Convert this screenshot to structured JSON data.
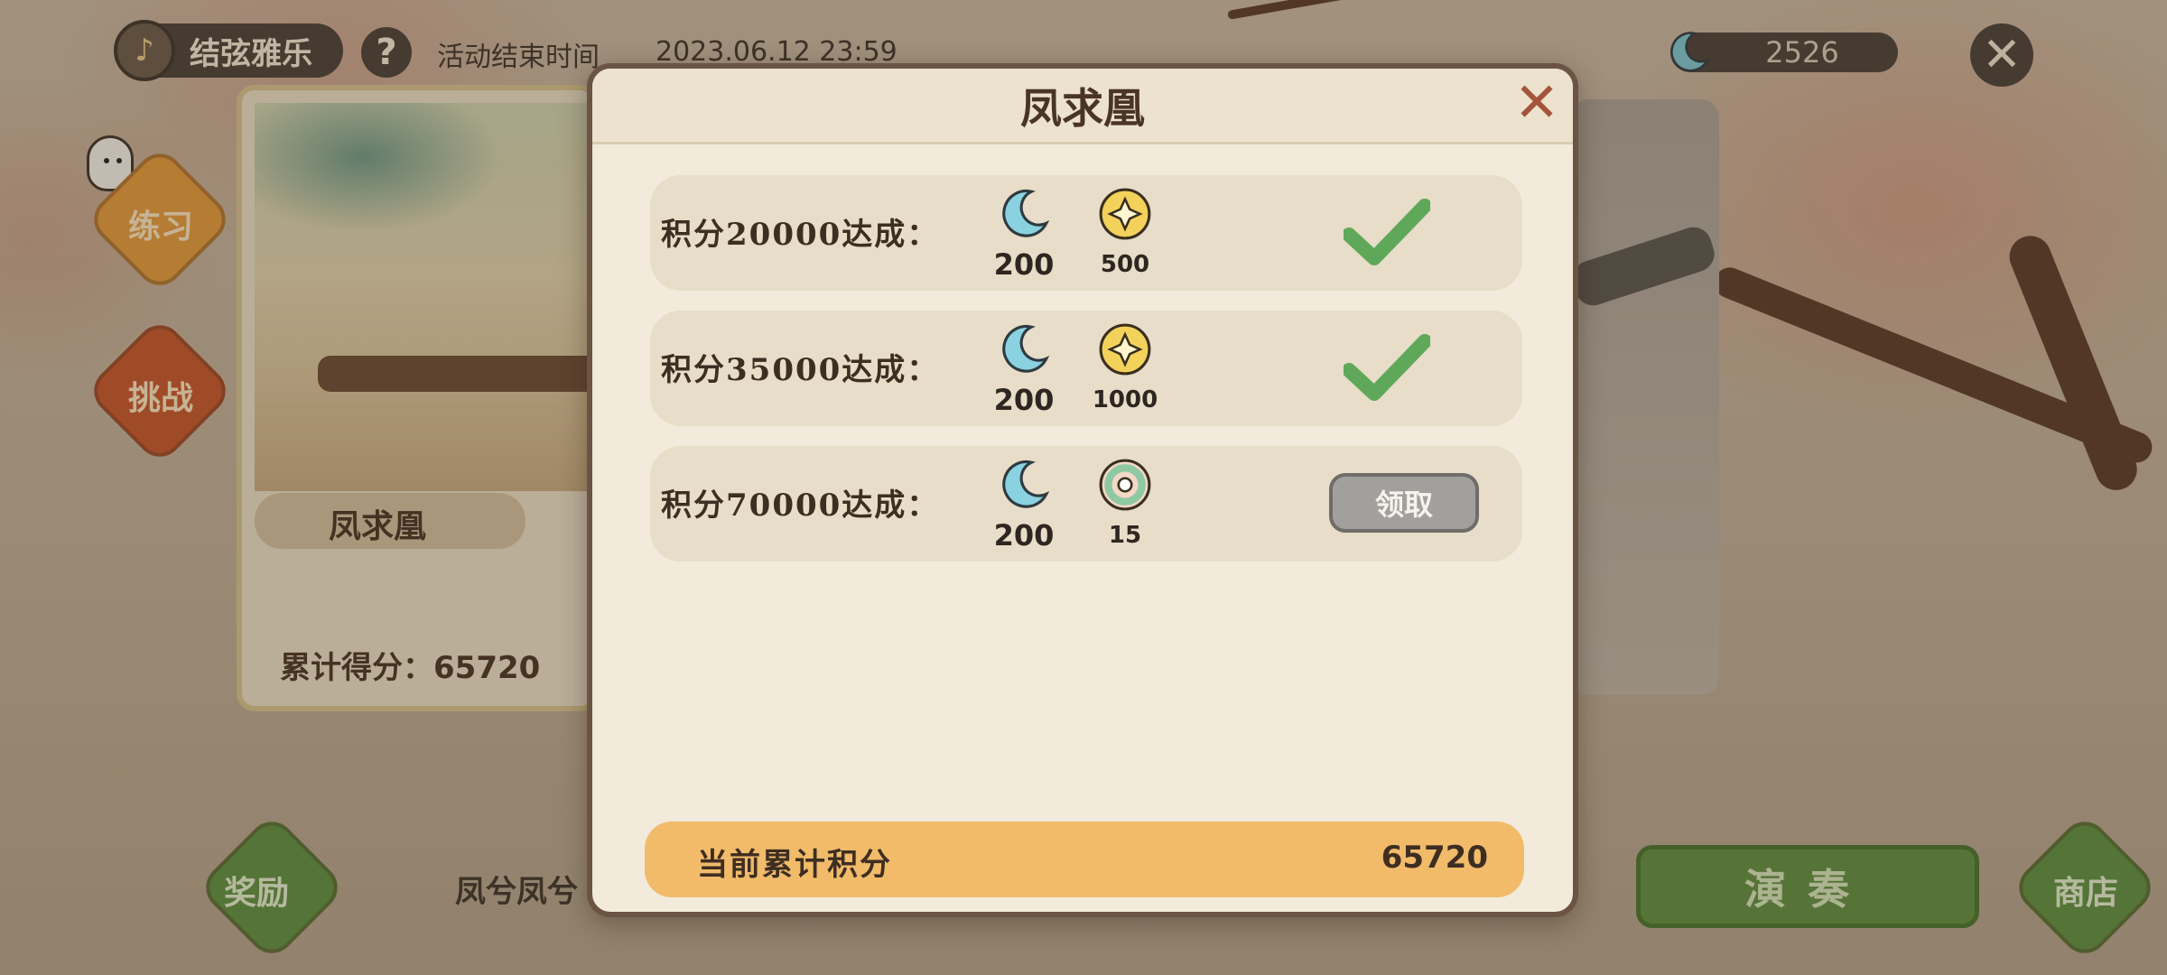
{
  "topbar": {
    "event_name": "结弦雅乐",
    "help": "?",
    "end_label": "活动结束时间",
    "end_time": "2023.06.12 23:59",
    "currency_amount": "2526",
    "close_icon": "✕"
  },
  "side_menu": {
    "practice": "练习",
    "challenge": "挑战"
  },
  "song_card": {
    "title": "凤求凰",
    "score_label": "累计得分：",
    "score_value": "65720"
  },
  "bottom_bar": {
    "reward": "奖励",
    "song_name": "凤兮凤兮",
    "play": "演奏",
    "shop": "商店"
  },
  "modal": {
    "title": "凤求凰",
    "close_icon": "✕",
    "rows": [
      {
        "label": "积分20000达成：",
        "moon_qty": "200",
        "item_qty": "500",
        "item_type": "gold-coin",
        "status": "claimed"
      },
      {
        "label": "积分35000达成：",
        "moon_qty": "200",
        "item_qty": "1000",
        "item_type": "gold-coin",
        "status": "claimed"
      },
      {
        "label": "积分70000达成：",
        "moon_qty": "200",
        "item_qty": "15",
        "item_type": "jade-ring",
        "status": "claimable",
        "claim_label": "领取"
      }
    ],
    "total_label": "当前累计积分",
    "total_value": "65720"
  },
  "colors": {
    "modal_bg": "#f2ebdb",
    "row_bg": "#e7ddc8",
    "total_bar": "#f1bb6a",
    "check_green": "#5fa85a",
    "play_green": "#608f43",
    "practice_orange": "#e39a3c",
    "challenge_red": "#c7562d"
  }
}
